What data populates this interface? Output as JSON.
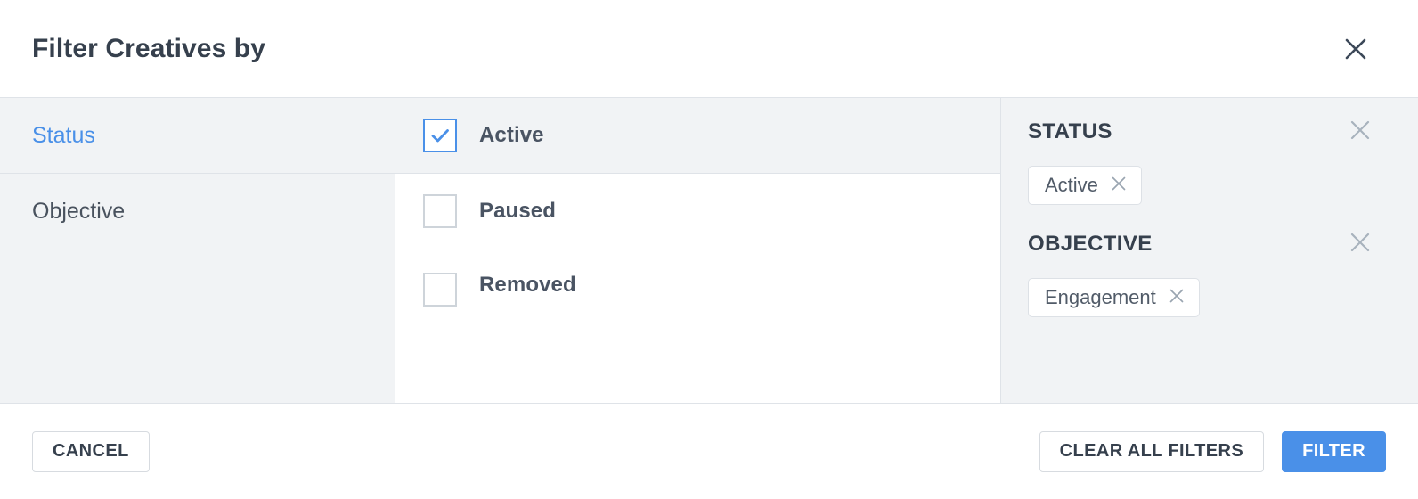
{
  "dialog": {
    "title": "Filter Creatives by",
    "close_icon": "close-icon"
  },
  "categories": [
    {
      "label": "Status",
      "selected": true
    },
    {
      "label": "Objective",
      "selected": false
    }
  ],
  "options": [
    {
      "label": "Active",
      "checked": true
    },
    {
      "label": "Paused",
      "checked": false
    },
    {
      "label": "Removed",
      "checked": false
    }
  ],
  "summary": {
    "groups": [
      {
        "title": "STATUS",
        "clear_icon": "close-icon",
        "chips": [
          {
            "label": "Active",
            "remove_icon": "close-icon"
          }
        ]
      },
      {
        "title": "OBJECTIVE",
        "clear_icon": "close-icon",
        "chips": [
          {
            "label": "Engagement",
            "remove_icon": "close-icon"
          }
        ]
      }
    ]
  },
  "footer": {
    "cancel_label": "CANCEL",
    "clear_all_label": "CLEAR ALL FILTERS",
    "filter_label": "FILTER"
  },
  "colors": {
    "accent": "#4a90e8",
    "panel_bg": "#f1f3f5",
    "border": "#dfe3e8",
    "text_dark": "#36404d",
    "icon_gray": "#a8b2bd"
  }
}
